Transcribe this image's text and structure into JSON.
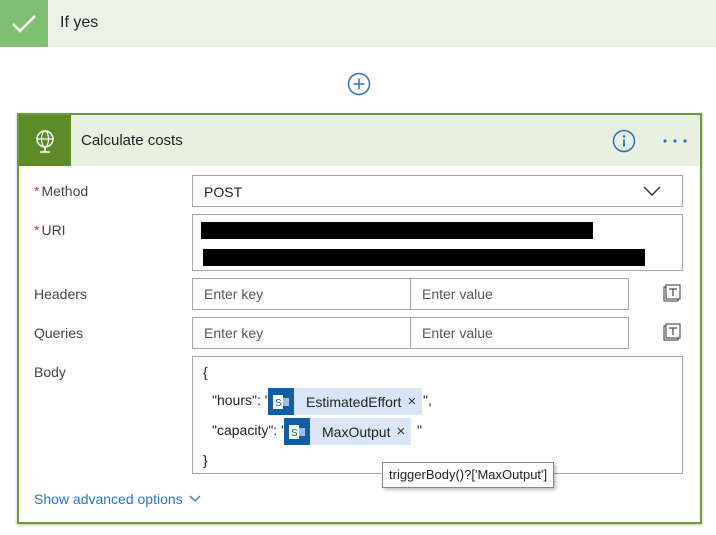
{
  "condition": {
    "label": "If yes"
  },
  "action": {
    "title": "Calculate costs",
    "icon": "globe-icon",
    "accent_color": "#5e8b2a",
    "required_marker": "*",
    "method": {
      "label": "Method",
      "value": "POST"
    },
    "uri": {
      "label": "URI"
    },
    "headers": {
      "label": "Headers",
      "key_placeholder": "Enter key",
      "value_placeholder": "Enter value"
    },
    "queries": {
      "label": "Queries",
      "key_placeholder": "Enter key",
      "value_placeholder": "Enter value"
    },
    "body": {
      "label": "Body",
      "open_brace": "{",
      "close_brace": "}",
      "line1_prefix": "\"hours\": \"",
      "line1_suffix": "\",",
      "line1_token": "EstimatedEffort",
      "line2_prefix": "\"capacity\": \"",
      "line2_suffix": "\"",
      "line2_token": "MaxOutput",
      "token_remove": "×"
    },
    "tooltip": "triggerBody()?['MaxOutput']",
    "advanced_link": "Show advanced options"
  }
}
